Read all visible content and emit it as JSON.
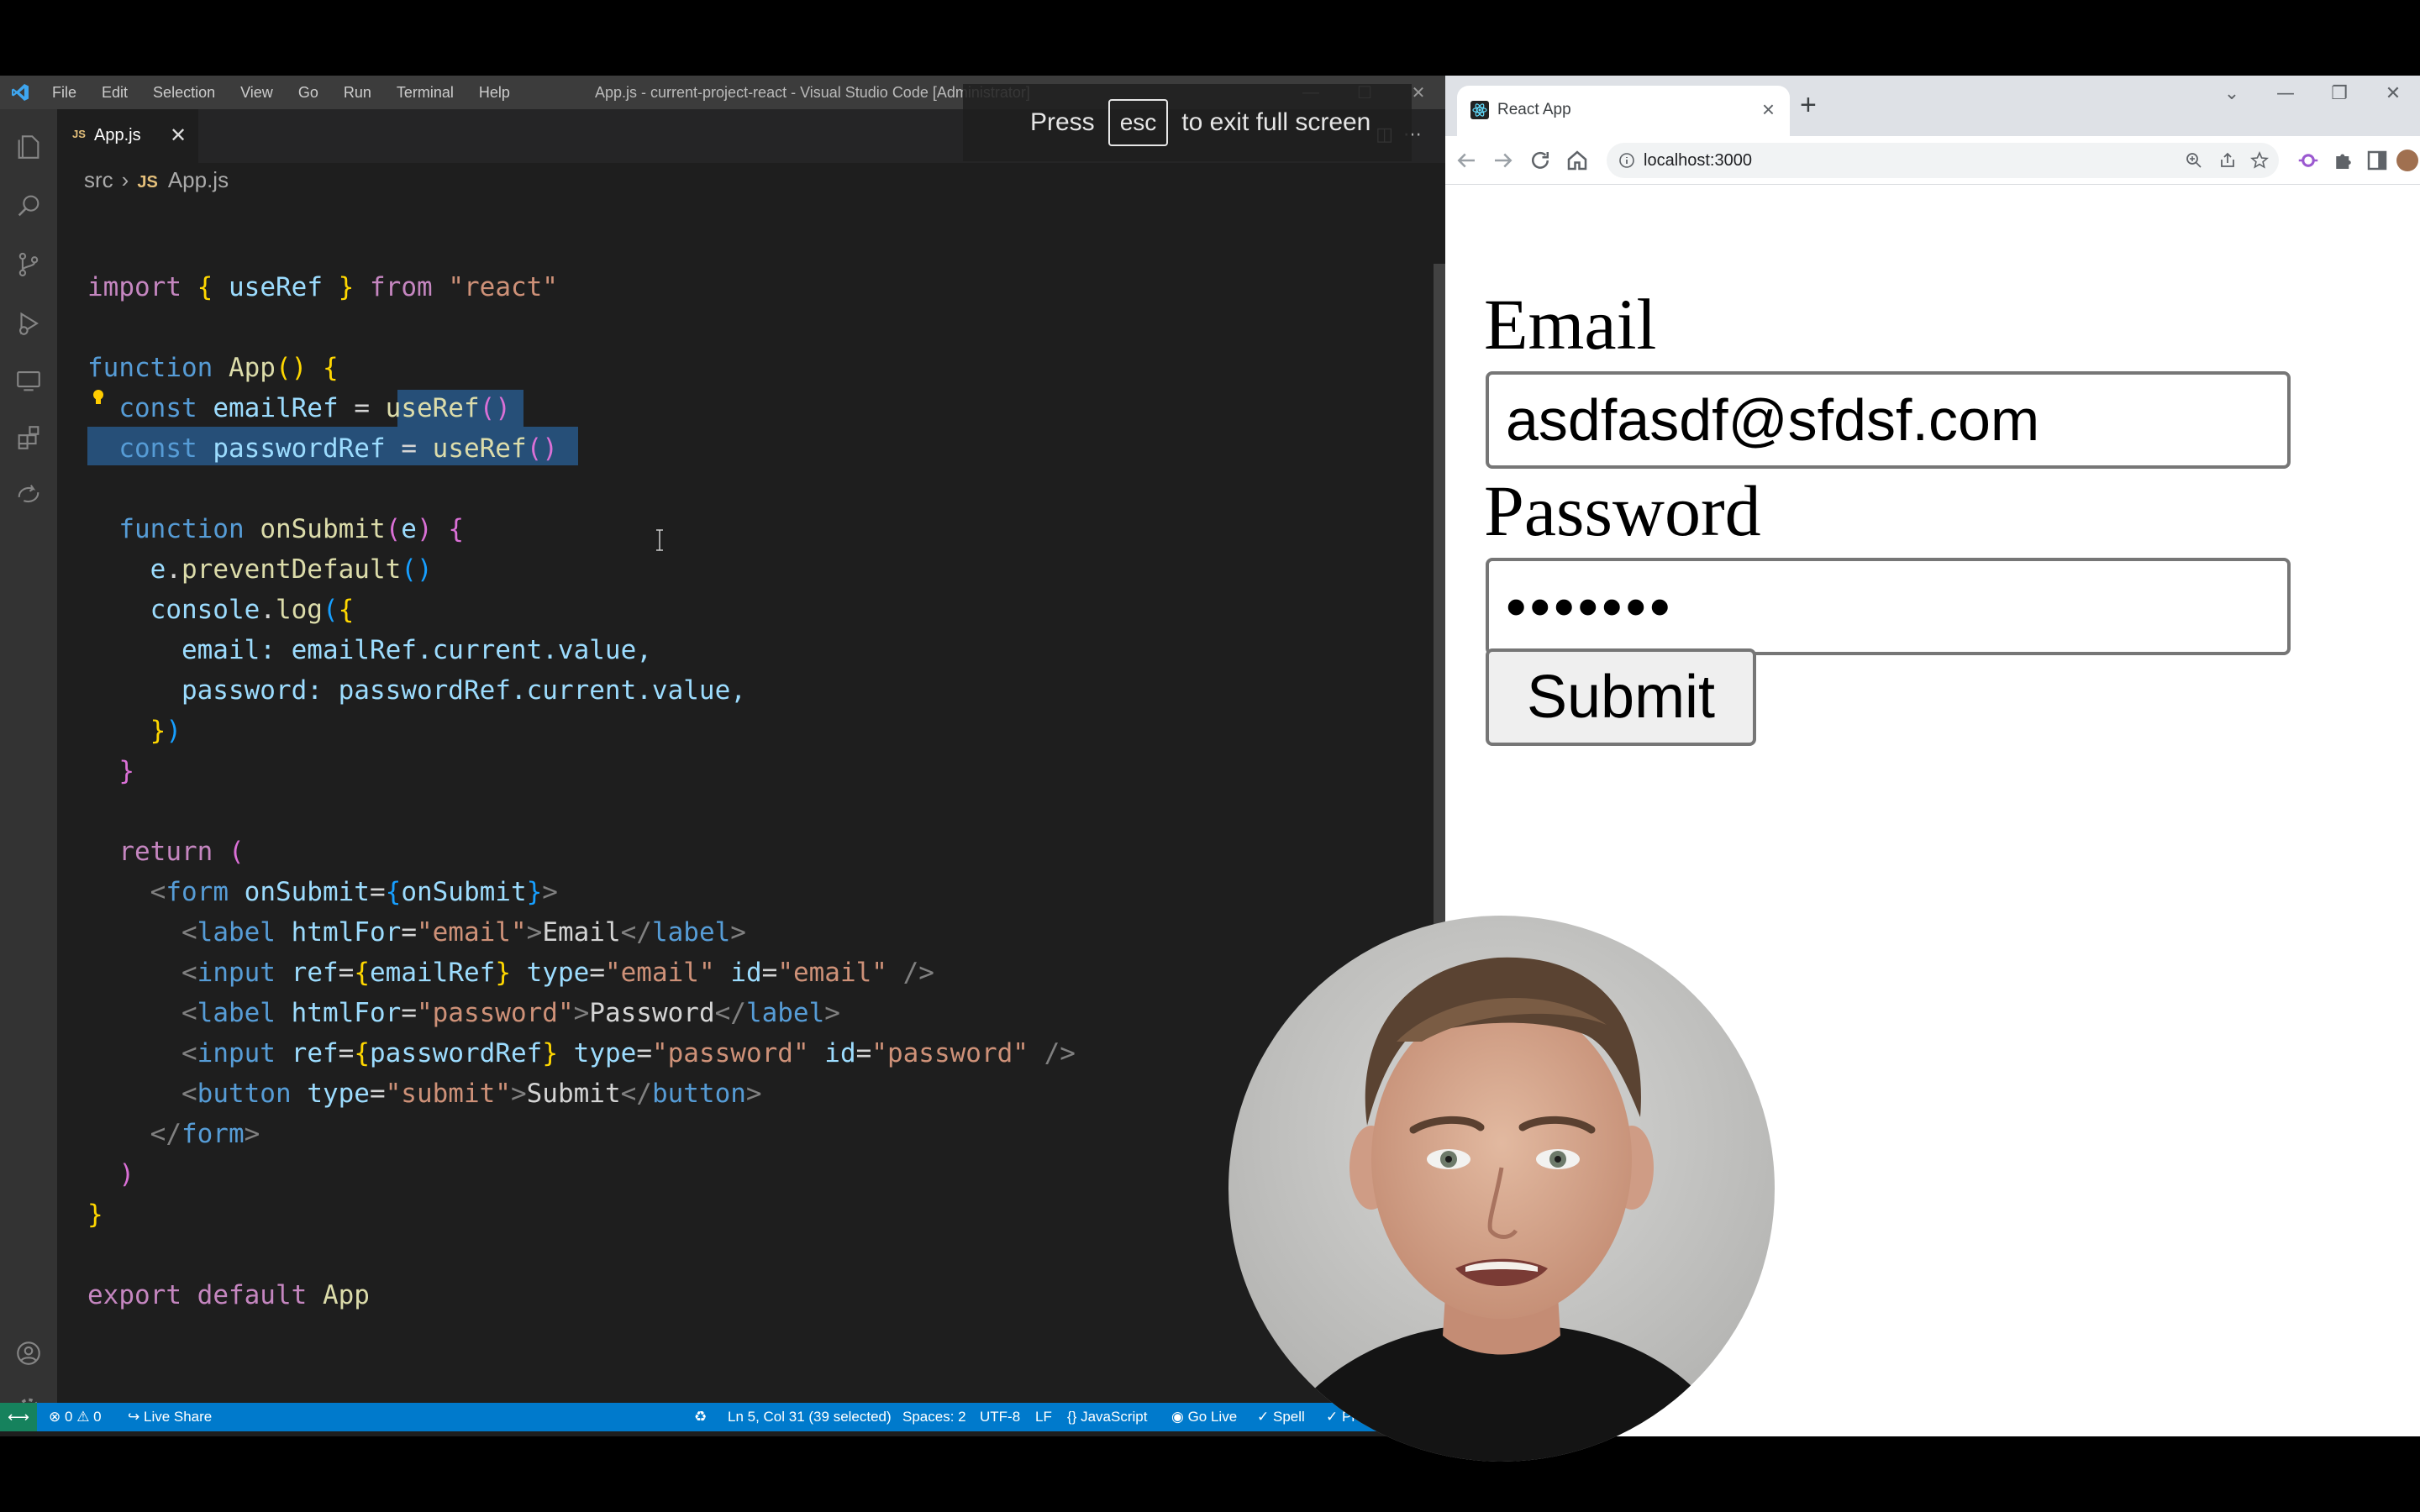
{
  "vscode": {
    "menu": [
      "File",
      "Edit",
      "Selection",
      "View",
      "Go",
      "Run",
      "Terminal",
      "Help"
    ],
    "window_title": "App.js - current-project-react - Visual Studio Code [Administrator]",
    "tab": {
      "badge": "JS",
      "label": "App.js"
    },
    "breadcrumb": {
      "folder": "src",
      "file_badge": "JS",
      "file": "App.js"
    },
    "fullscreen_notice": {
      "press": "Press",
      "key": "esc",
      "rest": "to exit full screen"
    },
    "code": {
      "l1": {
        "kw": "import",
        "b1": "{",
        "name": "useRef",
        "b2": "}",
        "from": "from",
        "mod": "\"react\""
      },
      "l3": {
        "kw": "function",
        "name": "App",
        "paren": "()",
        "brace": "{"
      },
      "l4": {
        "kw": "const",
        "name": "emailRef",
        "eq": "=",
        "call": "useRef",
        "paren": "()"
      },
      "l5": {
        "kw": "const",
        "name": "passwordRef",
        "eq": "=",
        "call": "useRef",
        "paren": "()"
      },
      "l7": {
        "kw": "function",
        "name": "onSubmit",
        "open": "(",
        "arg": "e",
        "close": ")",
        "brace": "{"
      },
      "l8": {
        "obj": "e",
        "dot": ".",
        "method": "preventDefault",
        "paren": "()"
      },
      "l9": {
        "obj": "console",
        "dot": ".",
        "method": "log",
        "open": "(",
        "brace": "{"
      },
      "l10": {
        "key": "email:",
        "ref": "emailRef",
        "rest": ".current.value,"
      },
      "l11": {
        "key": "password:",
        "ref": "passwordRef",
        "rest": ".current.value,"
      },
      "l12": {
        "brace": "}",
        "paren": ")"
      },
      "l13": {
        "brace": "}"
      },
      "l15": {
        "kw": "return",
        "paren": "("
      },
      "l16": {
        "open": "<",
        "tag": "form",
        "attr": "onSubmit",
        "eq": "=",
        "b1": "{",
        "val": "onSubmit",
        "b2": "}",
        "close": ">"
      },
      "l17": {
        "open": "<",
        "tag": "label",
        "attr": "htmlFor",
        "eq": "=",
        "val": "\"email\"",
        "close": ">",
        "text": "Email",
        "end_open": "</",
        "end_tag": "label",
        "end_close": ">"
      },
      "l18": {
        "open": "<",
        "tag": "input",
        "attr1": "ref",
        "eq1": "=",
        "b1": "{",
        "val1": "emailRef",
        "b2": "}",
        "attr2": "type",
        "eq2": "=",
        "val2": "\"email\"",
        "attr3": "id",
        "eq3": "=",
        "val3": "\"email\"",
        "close": "/>"
      },
      "l19": {
        "open": "<",
        "tag": "label",
        "attr": "htmlFor",
        "eq": "=",
        "val": "\"password\"",
        "close": ">",
        "text": "Password",
        "end_open": "</",
        "end_tag": "label",
        "end_close": ">"
      },
      "l20": {
        "open": "<",
        "tag": "input",
        "attr1": "ref",
        "eq1": "=",
        "b1": "{",
        "val1": "passwordRef",
        "b2": "}",
        "attr2": "type",
        "eq2": "=",
        "val2": "\"password\"",
        "attr3": "id",
        "eq3": "=",
        "val3": "\"password\"",
        "close": "/>"
      },
      "l21": {
        "open": "<",
        "tag": "button",
        "attr": "type",
        "eq": "=",
        "val": "\"submit\"",
        "close": ">",
        "text": "Submit",
        "end_open": "</",
        "end_tag": "button",
        "end_close": ">"
      },
      "l22": {
        "open": "</",
        "tag": "form",
        "close": ">"
      },
      "l23": {
        "paren": ")"
      },
      "l24": {
        "brace": "}"
      },
      "l26": {
        "kw1": "export",
        "kw2": "default",
        "name": "App"
      }
    },
    "status": {
      "errors": "0",
      "warnings": "0",
      "live_share": "Live Share",
      "position": "Ln 5, Col 31 (39 selected)",
      "spaces": "Spaces: 2",
      "encoding": "UTF-8",
      "eol": "LF",
      "language": "JavaScript",
      "go_live": "Go Live",
      "spell": "Spell",
      "prettier": "Prettier"
    }
  },
  "browser": {
    "tab_title": "React App",
    "url": "localhost:3000",
    "form": {
      "email_label": "Email",
      "email_value": "asdfasdf@sfdsf.com",
      "password_label": "Password",
      "password_mask": "•••••••",
      "submit_label": "Submit"
    }
  },
  "colors": {
    "editor_bg": "#1e1e1e",
    "status_bar": "#007acc",
    "selection": "#264f78",
    "keyword": "#c586c0",
    "function": "#dcdcaa",
    "variable": "#9cdcfe",
    "string": "#ce9178"
  }
}
